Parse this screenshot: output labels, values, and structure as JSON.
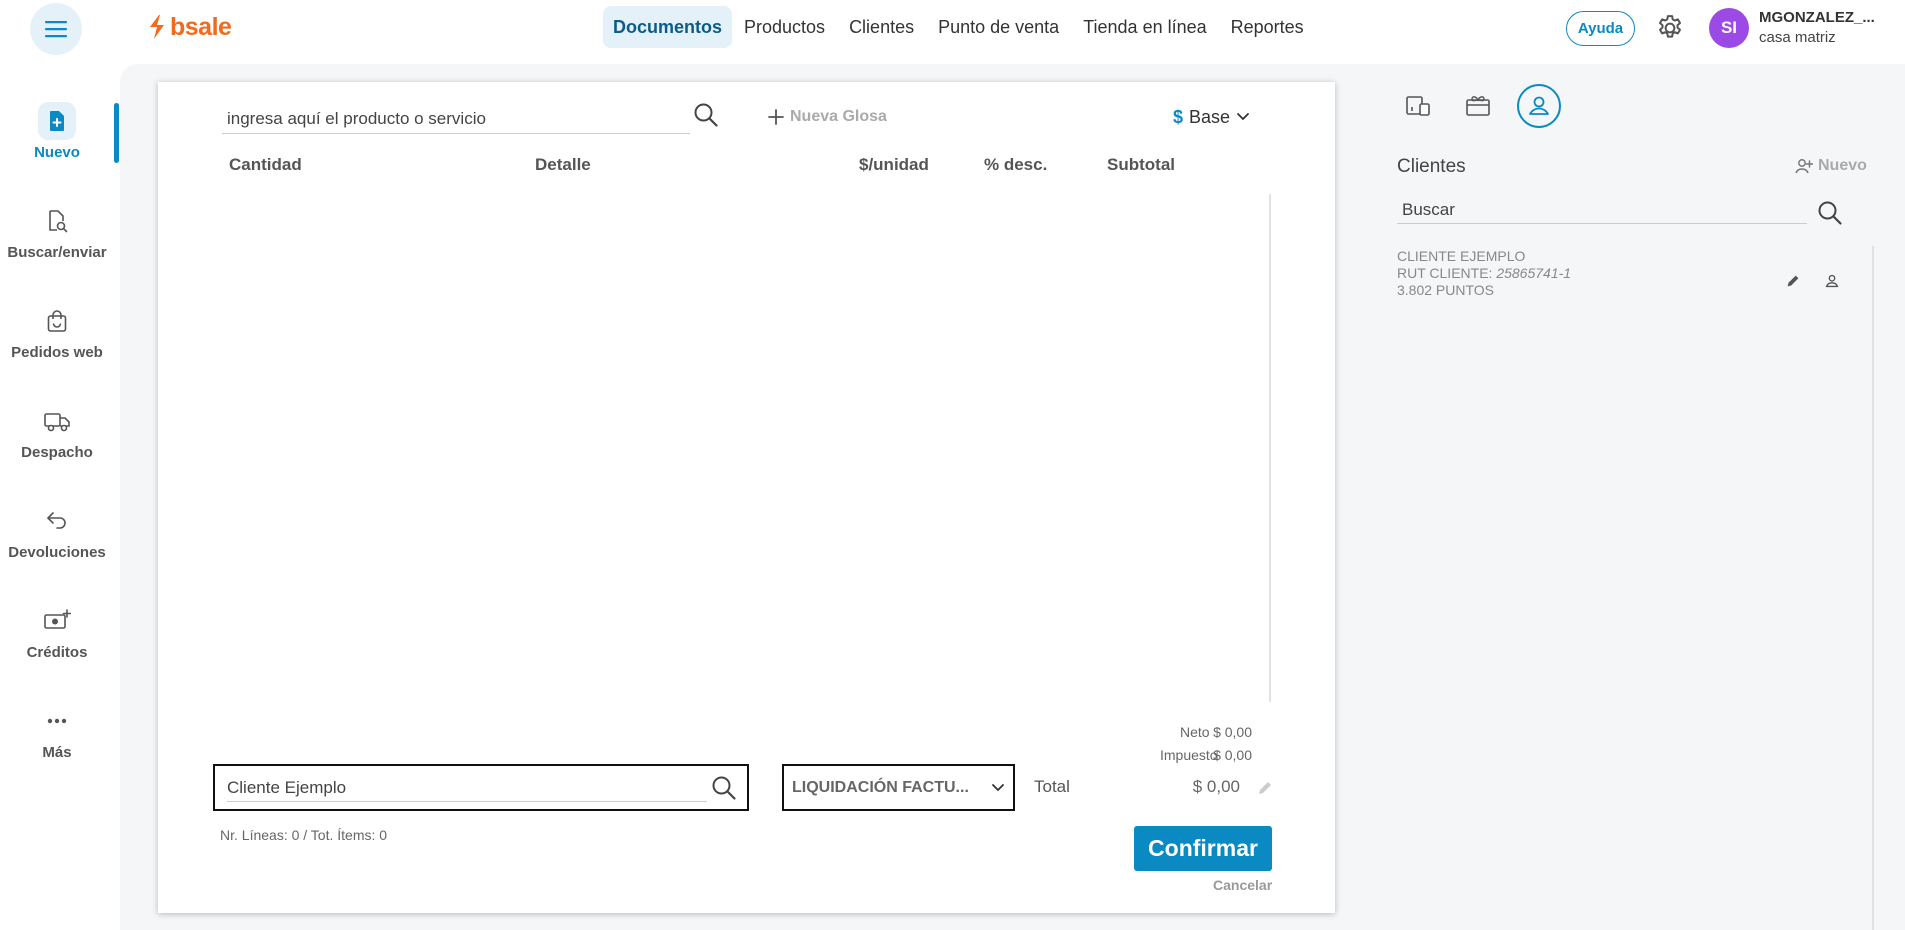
{
  "brand": {
    "logo_text": "bsale",
    "accent": "#0a8ac2",
    "logo_color": "#f26a1b"
  },
  "nav": {
    "items": [
      "Documentos",
      "Productos",
      "Clientes",
      "Punto de venta",
      "Tienda en línea",
      "Reportes"
    ],
    "active": "Documentos"
  },
  "header": {
    "help": "Ayuda",
    "avatar_initials": "SI",
    "user_name": "MGONZALEZ_...",
    "branch": "casa matriz"
  },
  "sidebar": {
    "items": [
      {
        "label": "Nuevo",
        "icon": "file-plus-icon",
        "active": true
      },
      {
        "label": "Buscar/enviar",
        "icon": "file-search-icon"
      },
      {
        "label": "Pedidos web",
        "icon": "shopping-bag-icon"
      },
      {
        "label": "Despacho",
        "icon": "truck-icon"
      },
      {
        "label": "Devoluciones",
        "icon": "return-arrow-icon"
      },
      {
        "label": "Créditos",
        "icon": "cash-plus-icon"
      },
      {
        "label": "Más",
        "icon": "more-dots-icon"
      }
    ]
  },
  "document": {
    "product_search_placeholder": "ingresa aquí el producto o servicio",
    "nueva_glosa": "Nueva Glosa",
    "price_list_symbol": "$",
    "price_list": "Base",
    "columns": [
      "Cantidad",
      "Detalle",
      "$/unidad",
      "% desc.",
      "Subtotal"
    ],
    "neto_label": "Neto",
    "neto_value": "$ 0,00",
    "impuesto_label": "Impuesto",
    "impuesto_value": "$ 0,00",
    "client_value": "Cliente Ejemplo",
    "doc_type": "LIQUIDACIÓN FACTU...",
    "total_label": "Total",
    "total_value": "$ 0,00",
    "line_count": "Nr. Líneas: 0 / Tot. Ítems: 0",
    "confirm": "Confirmar",
    "cancel": "Cancelar"
  },
  "right_panel": {
    "tabs": [
      "devices-icon",
      "gift-card-icon",
      "user-circle-icon"
    ],
    "title": "Clientes",
    "new_label": "Nuevo",
    "search_placeholder": "Buscar",
    "client": {
      "name": "CLIENTE EJEMPLO",
      "rut_label": "RUT CLIENTE:",
      "rut_value": "25865741-1",
      "points": "3.802 PUNTOS"
    }
  }
}
